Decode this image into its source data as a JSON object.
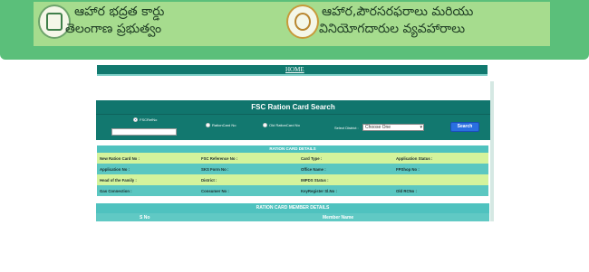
{
  "header": {
    "left_line1": "ఆహార భద్రత కార్డు",
    "left_line2": "తెలంగాణ ప్రభుత్వం",
    "right_line1": "ఆహార,పౌరసరఫరాలు మరియు",
    "right_line2": "వినియోగదారుల వ్యవహారాలు"
  },
  "menu": {
    "home_label": "HOME"
  },
  "search": {
    "title": "FSC Ration Card Search",
    "options": [
      "FSCRefNo",
      "RationCard No",
      "Old RationCard No"
    ],
    "selected_option": "FSCRefNo",
    "district_label": "Select District :",
    "district_value": "Choose One",
    "search_button": "Search"
  },
  "details": {
    "caption": "RATION CARD DETAILS",
    "rows": [
      [
        "New Ration Card No :",
        "FSC Reference No :",
        "Card Type :",
        "Application Status :"
      ],
      [
        "Application No :",
        "SKS Form No :",
        "Office Name :",
        "FPShop No :"
      ],
      [
        "Head of the Family :",
        "District :",
        "IMPDS Status :",
        ""
      ],
      [
        "Gas Connection :",
        "Consumer No :",
        "KeyRegister Sl.No :",
        "Old RCNo :"
      ]
    ]
  },
  "members": {
    "caption": "RATION CARD MEMBER DETAILS",
    "col_sno": "S No",
    "col_name": "Member Name"
  },
  "colors": {
    "header_green": "#5bbf7a",
    "banner_green": "#a6dc8e",
    "teal": "#10756d",
    "light_row": "#d4f39c",
    "teal_row": "#5bc7c1",
    "button_blue": "#2a6fe0"
  }
}
